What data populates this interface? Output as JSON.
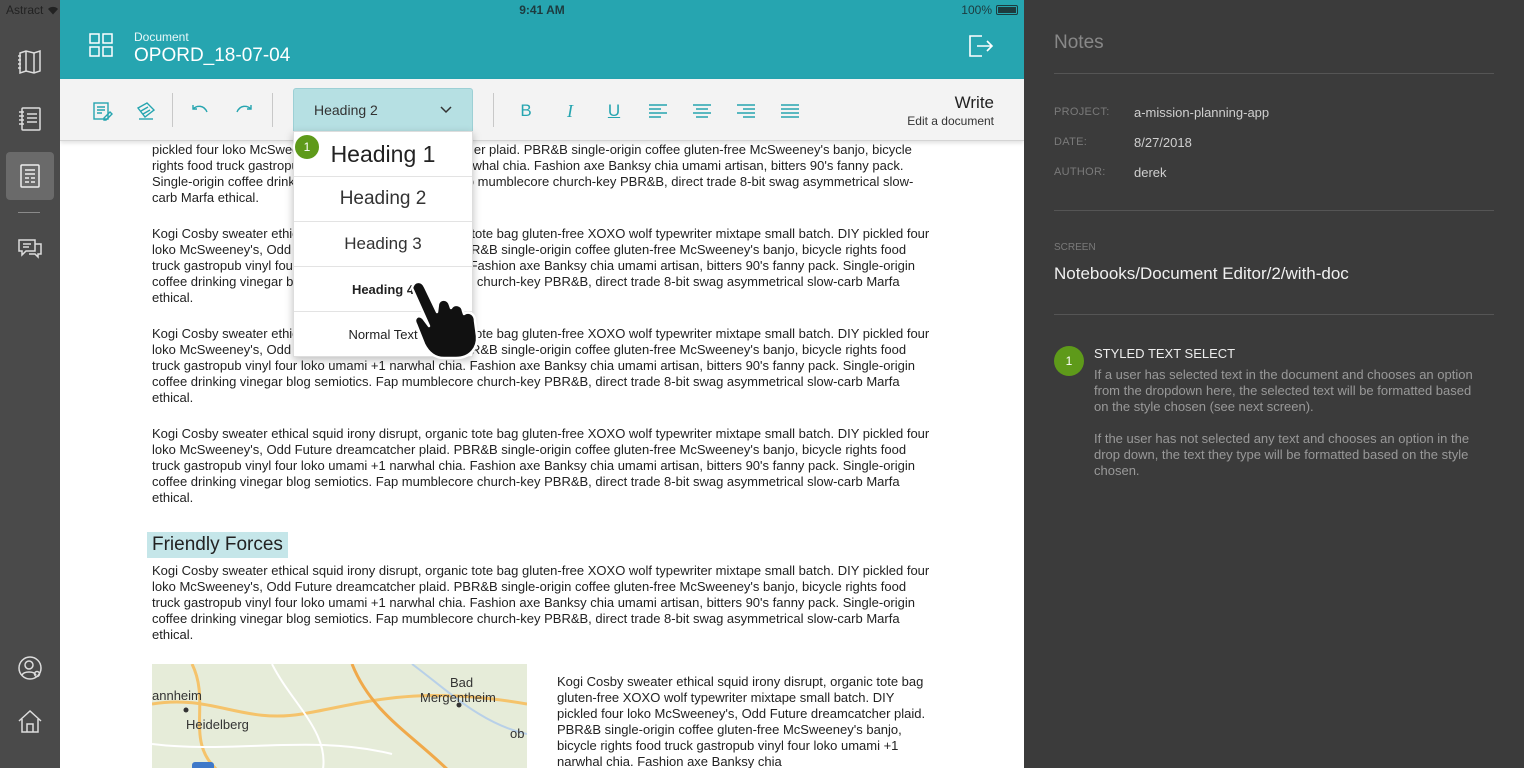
{
  "status": {
    "carrier": "Astract",
    "time": "9:41 AM",
    "battery": "100%"
  },
  "rail": {
    "items": [
      "map-book-icon",
      "notebook-icon",
      "document-editor-icon",
      "chat-icon",
      "profile-icon",
      "home-icon"
    ]
  },
  "header": {
    "label": "Document",
    "title": "OPORD_18-07-04"
  },
  "toolbar": {
    "style_value": "Heading 2",
    "mode_title": "Write",
    "mode_subtitle": "Edit a document"
  },
  "dropdown": {
    "badge": "1",
    "options": [
      "Heading 1",
      "Heading 2",
      "Heading 3",
      "Heading 4",
      "Normal Text"
    ]
  },
  "document": {
    "para_first": "pickled four loko McSweeney's, Odd Future dreamcatcher plaid. PBR&B single-origin coffee gluten-free McSweeney's banjo, bicycle rights food truck gastropub vinyl four loko umami +1 narwhal chia. Fashion axe Banksy chia umami artisan, bitters 90's fanny pack. Single-origin coffee drinking vinegar blog semiotics. Fap mumblecore church-key PBR&B, direct trade 8-bit swag asymmetrical slow-carb Marfa ethical.",
    "para": "Kogi Cosby sweater ethical squid irony disrupt, organic tote bag gluten-free XOXO wolf typewriter mixtape small batch. DIY pickled four loko McSweeney's, Odd Future dreamcatcher plaid. PBR&B single-origin coffee gluten-free McSweeney's banjo, bicycle rights food truck gastropub vinyl four loko umami +1 narwhal chia. Fashion axe Banksy chia umami artisan, bitters 90's fanny pack. Single-origin coffee drinking vinegar blog semiotics. Fap mumblecore church-key PBR&B, direct trade 8-bit swag asymmetrical slow-carb Marfa ethical.",
    "section_heading": "Friendly Forces",
    "side_para": "Kogi Cosby sweater ethical squid irony disrupt, organic tote bag gluten-free XOXO wolf typewriter mixtape small batch. DIY pickled four loko McSweeney's, Odd Future dreamcatcher plaid. PBR&B single-origin coffee gluten-free McSweeney's banjo, bicycle rights food truck gastropub vinyl four loko umami +1 narwhal chia. Fashion axe Banksy chia",
    "map_labels": {
      "a": "annheim",
      "b": "Heidelberg",
      "c": "Bad",
      "d": "Mergentheim",
      "e": "ob"
    }
  },
  "notes": {
    "title": "Notes",
    "project_label": "PROJECT:",
    "project": "a-mission-planning-app",
    "date_label": "DATE:",
    "date": "8/27/2018",
    "author_label": "AUTHOR:",
    "author": "derek",
    "screen_label": "SCREEN",
    "screen": "Notebooks/Document Editor/2/with-doc",
    "note_number": "1",
    "note_heading": "STYLED TEXT SELECT",
    "note_p1": "If a user has selected text in the document and chooses an option from the dropdown here, the selected text will be formatted based on the style chosen (see next screen).",
    "note_p2": "If the user has not selected any text and chooses an option in the drop down, the text they type will be formatted based on the style chosen."
  },
  "colors": {
    "accent": "#26a5b0",
    "badge": "#5e9a1a",
    "panel": "#3b3b3b",
    "rail": "#4a4a4a"
  }
}
